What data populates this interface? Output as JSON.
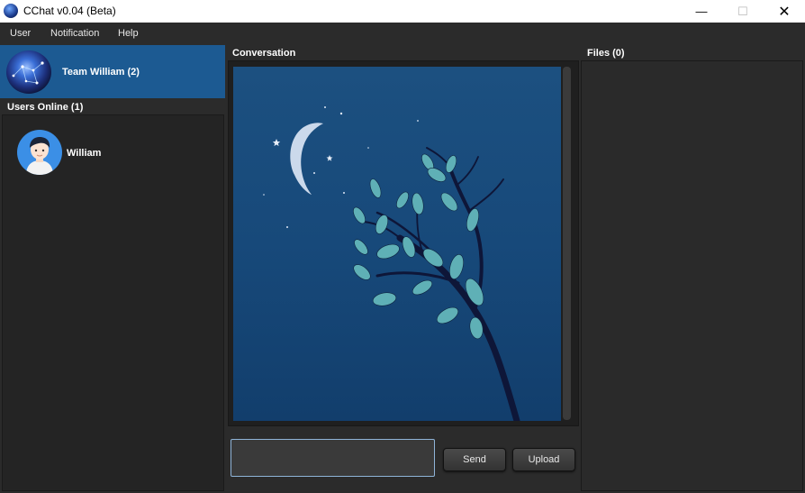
{
  "window": {
    "title": "CChat v0.04 (Beta)",
    "min_glyph": "—",
    "max_glyph": "☐",
    "close_glyph": "✕"
  },
  "menu": [
    {
      "label": "User"
    },
    {
      "label": "Notification"
    },
    {
      "label": "Help"
    }
  ],
  "team": {
    "name": "Team William (2)"
  },
  "users_online": {
    "label": "Users Online (1)",
    "users": [
      {
        "name": "William"
      }
    ]
  },
  "conversation": {
    "label": "Conversation",
    "image": "night-tree-moon-image"
  },
  "composer": {
    "value": "",
    "placeholder": "",
    "send_label": "Send",
    "upload_label": "Upload"
  },
  "files": {
    "label": "Files (0)"
  },
  "colors": {
    "team_header_bg": "#1c5a92",
    "panel_bg": "#2b2b2b",
    "input_border": "#8fb4d8"
  }
}
